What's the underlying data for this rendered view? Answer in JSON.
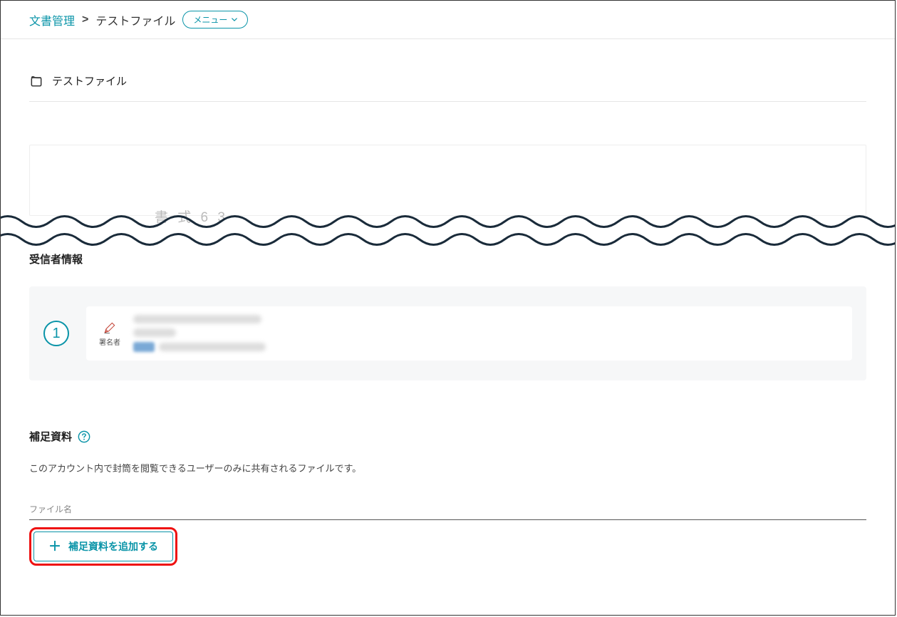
{
  "breadcrumb": {
    "root": "文書管理",
    "separator": ">",
    "current": "テストファイル",
    "menu_label": "メニュー"
  },
  "file": {
    "title": "テストファイル"
  },
  "preview": {
    "faint_text": "書 式 6 3"
  },
  "recipient": {
    "heading": "受信者情報",
    "number": "1",
    "signer_label": "署名者"
  },
  "supplement": {
    "heading": "補足資料",
    "description": "このアカウント内で封筒を閲覧できるユーザーのみに共有されるファイルです。",
    "filename_label": "ファイル名",
    "add_button": "補足資料を追加する"
  },
  "colors": {
    "accent": "#0a94a8",
    "highlight_border": "#e11"
  }
}
